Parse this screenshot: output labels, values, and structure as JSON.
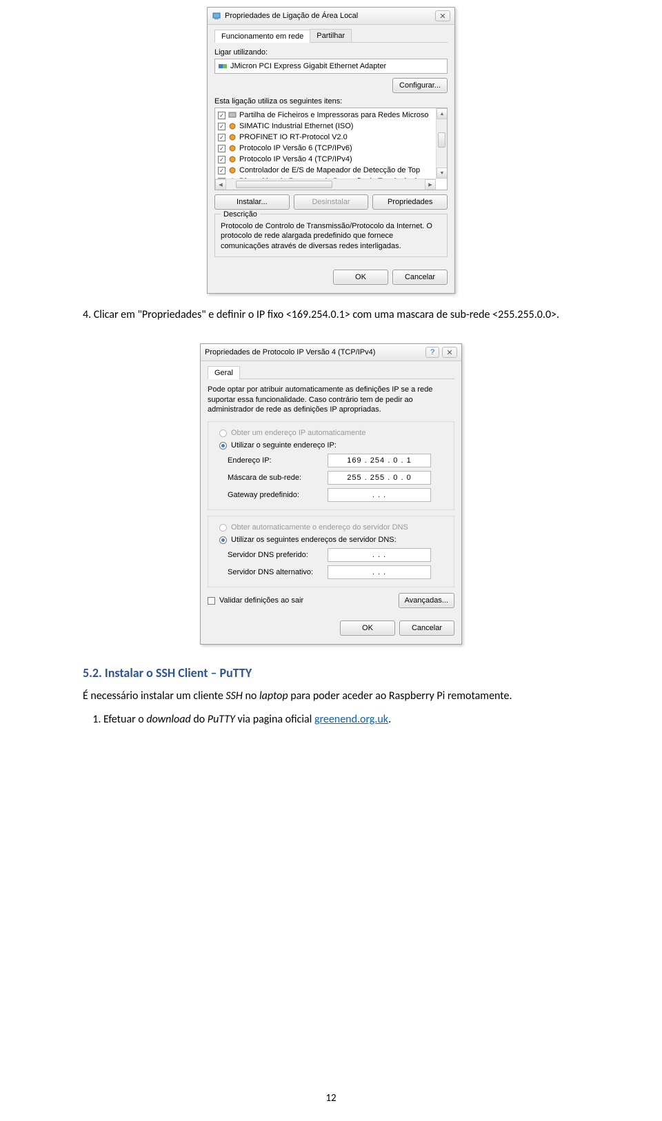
{
  "dialog1": {
    "title": "Propriedades de Ligação de Área Local",
    "tab_active": "Funcionamento em rede",
    "tab_other": "Partilhar",
    "connect_using_label": "Ligar utilizando:",
    "adapter": "JMicron PCI Express Gigabit Ethernet Adapter",
    "configure_btn": "Configurar...",
    "items_label": "Esta ligação utiliza os seguintes itens:",
    "items": [
      "Partilha de Ficheiros e Impressoras para Redes Microso",
      "SIMATIC Industrial Ethernet (ISO)",
      "PROFINET IO RT-Protocol V2.0",
      "Protocolo IP Versão 6 (TCP/IPv6)",
      "Protocolo IP Versão 4 (TCP/IPv4)",
      "Controlador de E/S de Mapeador de Detecção de Top",
      "Dispositivo de Resposta de Detecção de Topologia de"
    ],
    "install_btn": "Instalar...",
    "uninstall_btn": "Desinstalar",
    "properties_btn": "Propriedades",
    "desc_label": "Descrição",
    "desc_text": "Protocolo de Controlo de Transmissão/Protocolo da Internet. O protocolo de rede alargada predefinido que fornece comunicações através de diversas redes interligadas.",
    "ok": "OK",
    "cancel": "Cancelar"
  },
  "para4": "4. Clicar em \"Propriedades\" e definir o IP fixo <169.254.0.1> com uma mascara de sub-rede <255.255.0.0>.",
  "dialog2": {
    "title": "Propriedades de Protocolo IP Versão 4 (TCP/IPv4)",
    "tab": "Geral",
    "info": "Pode optar por atribuir automaticamente as definições IP se a rede suportar essa funcionalidade. Caso contrário tem de pedir ao administrador de rede as definições IP apropriadas.",
    "radio_auto": "Obter um endereço IP automaticamente",
    "radio_manual": "Utilizar o seguinte endereço IP:",
    "f_ip_lbl": "Endereço IP:",
    "f_ip_val": "169 . 254 .  0  .  1",
    "f_mask_lbl": "Máscara de sub-rede:",
    "f_mask_val": "255 . 255 .  0  .  0",
    "f_gw_lbl": "Gateway predefinido:",
    "f_gw_val": ".      .      .",
    "radio_dns_auto": "Obter automaticamente o endereço do servidor DNS",
    "radio_dns_manual": "Utilizar os seguintes endereços de servidor DNS:",
    "f_dns1_lbl": "Servidor DNS preferido:",
    "f_dns1_val": ".      .      .",
    "f_dns2_lbl": "Servidor DNS alternativo:",
    "f_dns2_val": ".      .      .",
    "validate": "Validar definições ao sair",
    "advanced": "Avançadas...",
    "ok": "OK",
    "cancel": "Cancelar"
  },
  "heading": "5.2. Instalar o SSH Client – PuTTY",
  "body_sentence_prefix": "É necessário instalar um cliente ",
  "body_ssh": "SSH",
  "body_mid": " no ",
  "body_laptop": "laptop",
  "body_suffix": " para poder aceder ao Raspberry Pi remotamente.",
  "li_prefix": "Efetuar o ",
  "li_download": "download",
  "li_mid": " do ",
  "li_putty": "PuTTY",
  "li_via": " via pagina oficial ",
  "li_link": "greenend.org.uk",
  "li_dot": ".",
  "page_number": "12"
}
